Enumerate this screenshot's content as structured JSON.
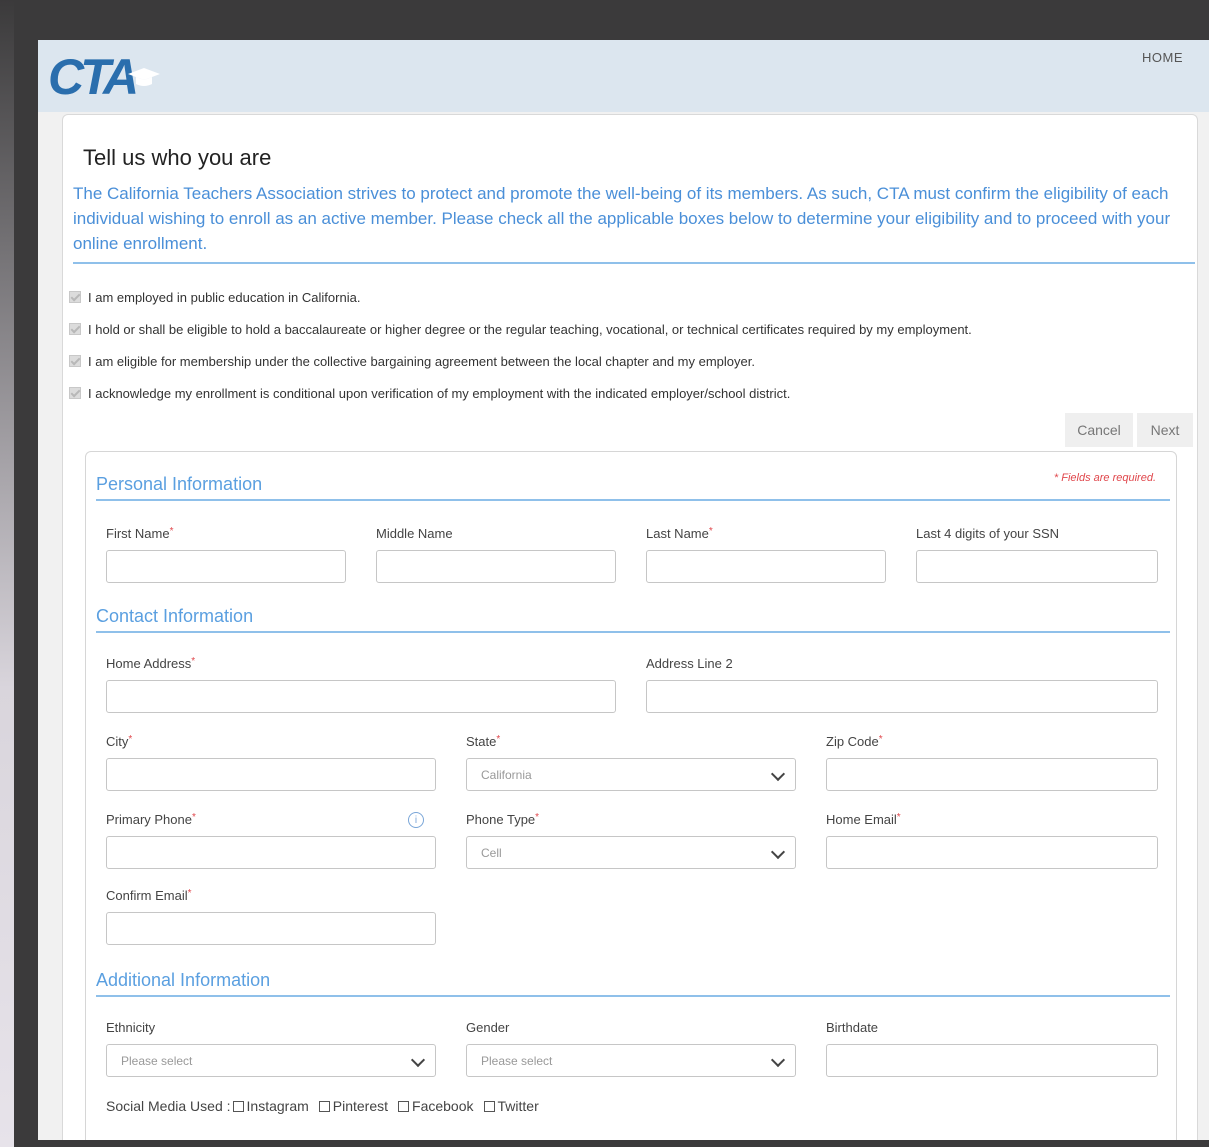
{
  "header": {
    "home_label": "HOME",
    "brand_color": "#2a6ead"
  },
  "page": {
    "title": "Tell us who you are",
    "intro": "The California Teachers Association strives to protect and promote the well-being of its members. As such, CTA must confirm the eligibility of each individual wishing to enroll as an active member. Please check all the applicable boxes below to determine your eligibility and to proceed with your online enrollment."
  },
  "eligibility": [
    "I am employed in public education in California.",
    "I hold or shall be eligible to hold a baccalaureate or higher degree or the regular teaching, vocational, or technical certificates required by my employment.",
    "I am eligible for membership under the collective bargaining agreement between the local chapter and my employer.",
    "I acknowledge my enrollment is conditional upon verification of my employment with the indicated employer/school district."
  ],
  "actions": {
    "cancel": "Cancel",
    "next": "Next"
  },
  "form": {
    "required_note": "* Fields are required.",
    "personal": {
      "heading": "Personal Information",
      "first_name": "First Name",
      "middle_name": "Middle Name",
      "last_name": "Last Name",
      "ssn": "Last 4 digits of your SSN"
    },
    "contact": {
      "heading": "Contact Information",
      "home_address": "Home Address",
      "address_line2": "Address Line 2",
      "city": "City",
      "state": "State",
      "state_value": "California",
      "zip": "Zip Code",
      "primary_phone": "Primary Phone",
      "phone_type": "Phone Type",
      "phone_type_value": "Cell",
      "home_email": "Home Email",
      "confirm_email": "Confirm Email"
    },
    "additional": {
      "heading": "Additional Information",
      "ethnicity": "Ethnicity",
      "ethnicity_value": "Please select",
      "gender": "Gender",
      "gender_value": "Please select",
      "birthdate": "Birthdate",
      "social_label": "Social Media Used :",
      "social_options": [
        "Instagram",
        "Pinterest",
        "Facebook",
        "Twitter"
      ]
    }
  }
}
